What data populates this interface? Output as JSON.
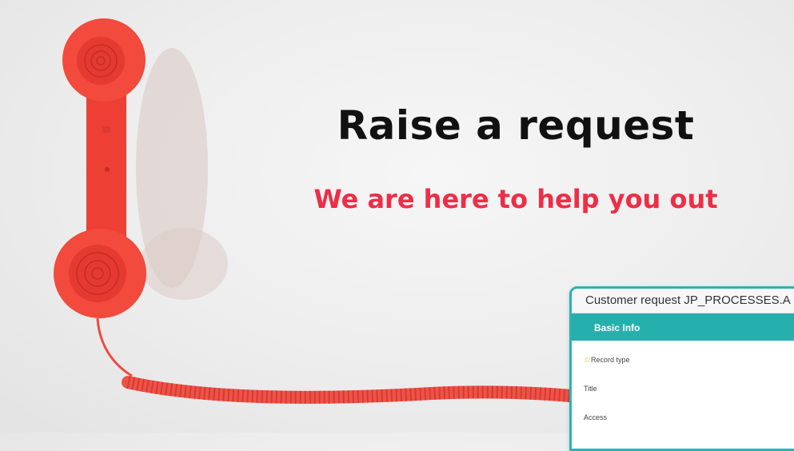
{
  "banner": {
    "headline": "Raise a request",
    "subline": "We are here to help you out"
  },
  "form": {
    "title": "Customer request JP_PROCESSES.A",
    "tab_label": "Basic Info",
    "fields": [
      {
        "label": "Record type",
        "required": true
      },
      {
        "label": "Title",
        "required": false
      },
      {
        "label": "Access",
        "required": false
      }
    ]
  },
  "colors": {
    "headline": "#111111",
    "subline": "#ef2d46",
    "phone": "#f24a3c",
    "tab_accent": "#26b0ad"
  },
  "icons": {
    "phone": "telephone-handset-icon",
    "required": "star-icon"
  }
}
